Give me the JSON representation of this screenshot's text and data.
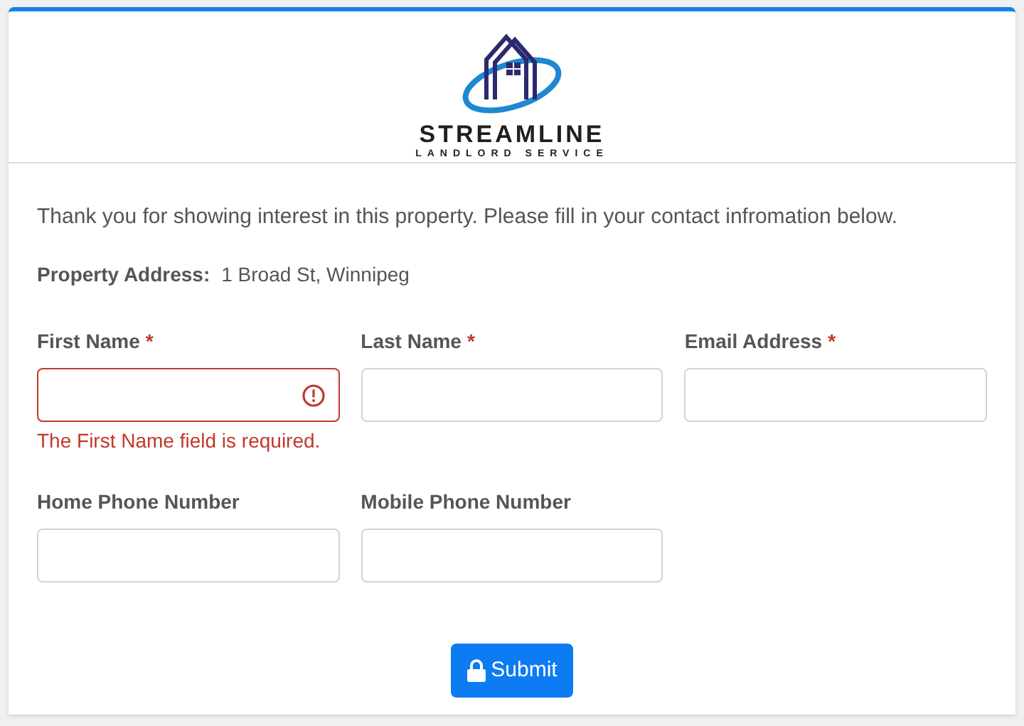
{
  "logo": {
    "name": "STREAMLINE",
    "tagline": "LANDLORD SERVICE"
  },
  "intro": "Thank you for showing interest in this property. Please fill in your contact infromation below.",
  "property": {
    "label": "Property Address:",
    "value": "1 Broad St, Winnipeg"
  },
  "fields": [
    {
      "label": "First Name",
      "required": true,
      "invalid": true,
      "error": "The First Name field is required."
    },
    {
      "label": "Last Name",
      "required": true,
      "invalid": false
    },
    {
      "label": "Email Address",
      "required": true,
      "invalid": false
    },
    {
      "label": "Home Phone Number",
      "required": false,
      "invalid": false
    },
    {
      "label": "Mobile Phone Number",
      "required": false,
      "invalid": false
    }
  ],
  "required_mark": "*",
  "submit": {
    "label": "Submit"
  }
}
